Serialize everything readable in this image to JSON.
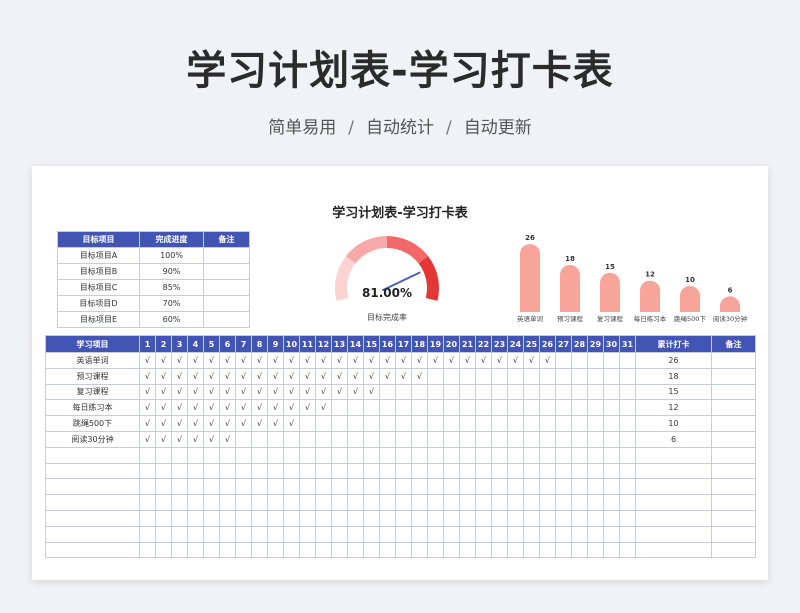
{
  "header": {
    "title": "学习计划表-学习打卡表",
    "tags": [
      "简单易用",
      "自动统计",
      "自动更新"
    ],
    "separator": "/"
  },
  "sheet_title": "学习计划表-学习打卡表",
  "goals": {
    "headers": [
      "目标项目",
      "完成进度",
      "备注"
    ],
    "rows": [
      {
        "name": "目标项目A",
        "progress": "100%"
      },
      {
        "name": "目标项目B",
        "progress": "90%"
      },
      {
        "name": "目标项目C",
        "progress": "85%"
      },
      {
        "name": "目标项目D",
        "progress": "70%"
      },
      {
        "name": "目标项目E",
        "progress": "60%"
      }
    ]
  },
  "gauge": {
    "value": 81.0,
    "value_label": "81.00%",
    "label": "目标完成率",
    "colors": [
      "#fbd3d3",
      "#f7a9a9",
      "#f26767",
      "#e53535"
    ],
    "needle_color": "#4a5fbf"
  },
  "chart_data": {
    "type": "bar",
    "categories": [
      "英语单词",
      "预习课程",
      "复习课程",
      "每日练习本",
      "跳绳500下",
      "阅读30分钟"
    ],
    "values": [
      26,
      18,
      15,
      12,
      10,
      6
    ],
    "ylim": [
      0,
      26
    ],
    "grid": false,
    "bar_color": "#f7a59b"
  },
  "checkin": {
    "project_header": "学习项目",
    "days": [
      "1",
      "2",
      "3",
      "4",
      "5",
      "6",
      "7",
      "8",
      "9",
      "10",
      "11",
      "12",
      "13",
      "14",
      "15",
      "16",
      "17",
      "18",
      "19",
      "20",
      "21",
      "22",
      "23",
      "24",
      "25",
      "26",
      "27",
      "28",
      "29",
      "30",
      "31"
    ],
    "total_header": "累计打卡",
    "note_header": "备注",
    "mark": "√",
    "rows": [
      {
        "name": "英语单词",
        "count": 26,
        "total": "26"
      },
      {
        "name": "预习课程",
        "count": 18,
        "total": "18"
      },
      {
        "name": "复习课程",
        "count": 15,
        "total": "15"
      },
      {
        "name": "每日练习本",
        "count": 12,
        "total": "12"
      },
      {
        "name": "跳绳500下",
        "count": 10,
        "total": "10"
      },
      {
        "name": "阅读30分钟",
        "count": 6,
        "total": "6"
      }
    ],
    "empty_rows": 7
  }
}
